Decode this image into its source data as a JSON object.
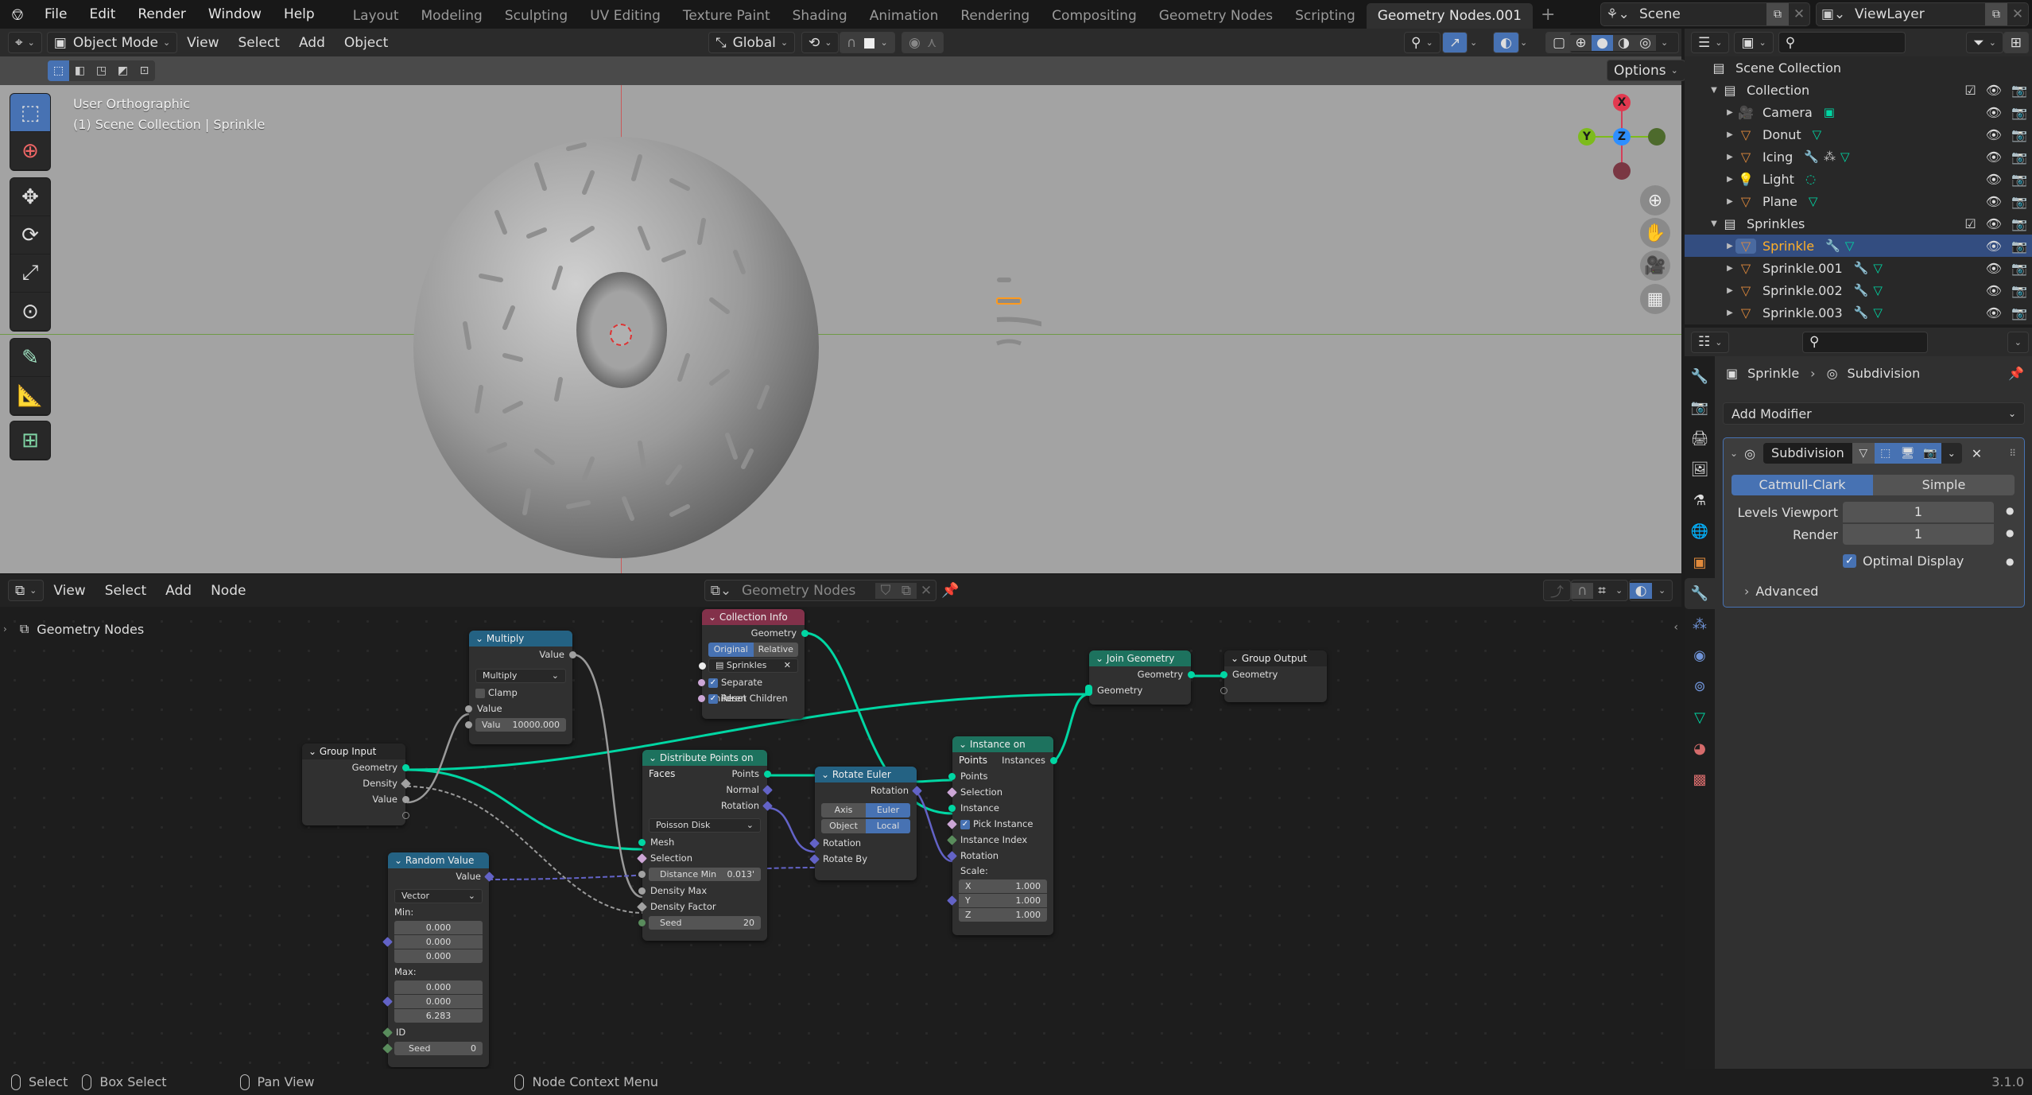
{
  "app": {
    "version": "3.1.0"
  },
  "topbar": {
    "menus": [
      "File",
      "Edit",
      "Render",
      "Window",
      "Help"
    ],
    "workspaces": [
      "Layout",
      "Modeling",
      "Sculpting",
      "UV Editing",
      "Texture Paint",
      "Shading",
      "Animation",
      "Rendering",
      "Compositing",
      "Geometry Nodes",
      "Scripting",
      "Geometry Nodes.001"
    ],
    "active_workspace": "Geometry Nodes.001",
    "add_workspace": "+",
    "scene": "Scene",
    "view_layer": "ViewLayer"
  },
  "viewport": {
    "mode": "Object Mode",
    "menus": [
      "View",
      "Select",
      "Add",
      "Object"
    ],
    "transform_orientation": "Global",
    "options_label": "Options",
    "view_name": "User Orthographic",
    "context_info": "(1) Scene Collection | Sprinkle",
    "gizmo_axes": {
      "x": "X",
      "y": "Y",
      "z": "Z"
    },
    "colors": {
      "x_axis": "#e2394f",
      "y_axis": "#7dbb1c",
      "z_axis": "#2e8fff",
      "grid_green": "#6e9a46",
      "selection": "#ff9a1e"
    }
  },
  "node_editor": {
    "menus": [
      "View",
      "Select",
      "Add",
      "Node"
    ],
    "node_tree_name": "Geometry Nodes",
    "breadcrumb": "Geometry Nodes",
    "nodes": {
      "group_input": {
        "title": "Group Input",
        "outputs": [
          "Geometry",
          "Density",
          "Value"
        ]
      },
      "multiply": {
        "title": "Multiply",
        "output": "Value",
        "operation": "Multiply",
        "clamp_label": "Clamp",
        "clamp": false,
        "input_label": "Value",
        "value_label": "Valu",
        "value": "10000.000"
      },
      "collection_info": {
        "title": "Collection Info",
        "output": "Geometry",
        "transform_options": [
          "Original",
          "Relative"
        ],
        "transform_active": "Original",
        "collection": "Sprinkles",
        "separate_children_label": "Separate Children",
        "separate_children": true,
        "reset_children_label": "Reset Children",
        "reset_children": true
      },
      "random_value": {
        "title": "Random Value",
        "output": "Value",
        "data_type": "Vector",
        "min_label": "Min:",
        "min": [
          "0.000",
          "0.000",
          "0.000"
        ],
        "max_label": "Max:",
        "max": [
          "0.000",
          "0.000",
          "6.283"
        ],
        "id_label": "ID",
        "seed_label": "Seed",
        "seed": "0"
      },
      "distribute": {
        "title": "Distribute Points on Faces",
        "outputs": [
          "Points",
          "Normal",
          "Rotation"
        ],
        "method": "Poisson Disk",
        "inputs": [
          "Mesh",
          "Selection"
        ],
        "distance_min_label": "Distance Min",
        "distance_min": "0.013'",
        "density_max_label": "Density Max",
        "density_factor_label": "Density Factor",
        "seed_label": "Seed",
        "seed": "20"
      },
      "rotate_euler": {
        "title": "Rotate Euler",
        "output": "Rotation",
        "type_options": [
          "Axis Angle",
          "Euler"
        ],
        "type_active": "Euler",
        "space_options": [
          "Object",
          "Local"
        ],
        "space_active": "Local",
        "inputs": [
          "Rotation",
          "Rotate By"
        ]
      },
      "instance_on_points": {
        "title": "Instance on Points",
        "output": "Instances",
        "inputs": [
          "Points",
          "Selection",
          "Instance"
        ],
        "pick_instance_label": "Pick Instance",
        "pick_instance": true,
        "instance_index_label": "Instance Index",
        "rotation_label": "Rotation",
        "scale_label": "Scale:",
        "scale": [
          {
            "axis": "X",
            "value": "1.000"
          },
          {
            "axis": "Y",
            "value": "1.000"
          },
          {
            "axis": "Z",
            "value": "1.000"
          }
        ]
      },
      "join_geometry": {
        "title": "Join Geometry",
        "output": "Geometry",
        "input": "Geometry"
      },
      "group_output": {
        "title": "Group Output",
        "input": "Geometry"
      }
    },
    "colors": {
      "geometry": "#00d6a3",
      "float": "#a1a1a1",
      "vector": "#6363c7",
      "boolean": "#cca6d6",
      "integer": "#598c5c",
      "input_header": "#83314a",
      "geometry_header": "#1d725e",
      "converter_header": "#246283",
      "group_header": "#1d1d1d"
    }
  },
  "outliner": {
    "root": "Scene Collection",
    "rows": [
      {
        "name": "Collection",
        "kind": "collection",
        "depth": 1,
        "checked": true
      },
      {
        "name": "Camera",
        "kind": "camera",
        "depth": 2,
        "extras": [
          "camera-data"
        ]
      },
      {
        "name": "Donut",
        "kind": "mesh",
        "depth": 2,
        "extras": [
          "mesh-data"
        ]
      },
      {
        "name": "Icing",
        "kind": "mesh",
        "depth": 2,
        "extras": [
          "modifier",
          "particles",
          "mesh-data"
        ]
      },
      {
        "name": "Light",
        "kind": "light",
        "depth": 2,
        "extras": [
          "light-data"
        ]
      },
      {
        "name": "Plane",
        "kind": "mesh",
        "depth": 2,
        "extras": [
          "mesh-data"
        ]
      },
      {
        "name": "Sprinkles",
        "kind": "collection",
        "depth": 1,
        "checked": true
      },
      {
        "name": "Sprinkle",
        "kind": "mesh",
        "depth": 2,
        "extras": [
          "modifier",
          "mesh-data"
        ],
        "selected": true
      },
      {
        "name": "Sprinkle.001",
        "kind": "mesh",
        "depth": 2,
        "extras": [
          "modifier",
          "mesh-data"
        ]
      },
      {
        "name": "Sprinkle.002",
        "kind": "mesh",
        "depth": 2,
        "extras": [
          "modifier",
          "mesh-data"
        ]
      },
      {
        "name": "Sprinkle.003",
        "kind": "mesh",
        "depth": 2,
        "extras": [
          "modifier",
          "mesh-data"
        ]
      }
    ]
  },
  "properties": {
    "breadcrumb": [
      "Sprinkle",
      "Subdivision"
    ],
    "add_modifier_label": "Add Modifier",
    "modifier": {
      "name": "Subdivision",
      "algorithms": [
        "Catmull-Clark",
        "Simple"
      ],
      "algorithm_active": "Catmull-Clark",
      "levels_viewport_label": "Levels Viewport",
      "levels_viewport": "1",
      "render_label": "Render",
      "render": "1",
      "optimal_display_label": "Optimal Display",
      "optimal_display": true,
      "advanced_label": "Advanced"
    },
    "tabs": [
      "tool",
      "render",
      "output",
      "view-layer",
      "scene",
      "world",
      "object",
      "modifiers",
      "particles",
      "physics",
      "constraints",
      "data",
      "material",
      "texture"
    ],
    "active_tab": "modifiers"
  },
  "statusbar": {
    "items": [
      "Select",
      "Box Select",
      "Pan View",
      "Node Context Menu"
    ],
    "version": "3.1.0"
  }
}
